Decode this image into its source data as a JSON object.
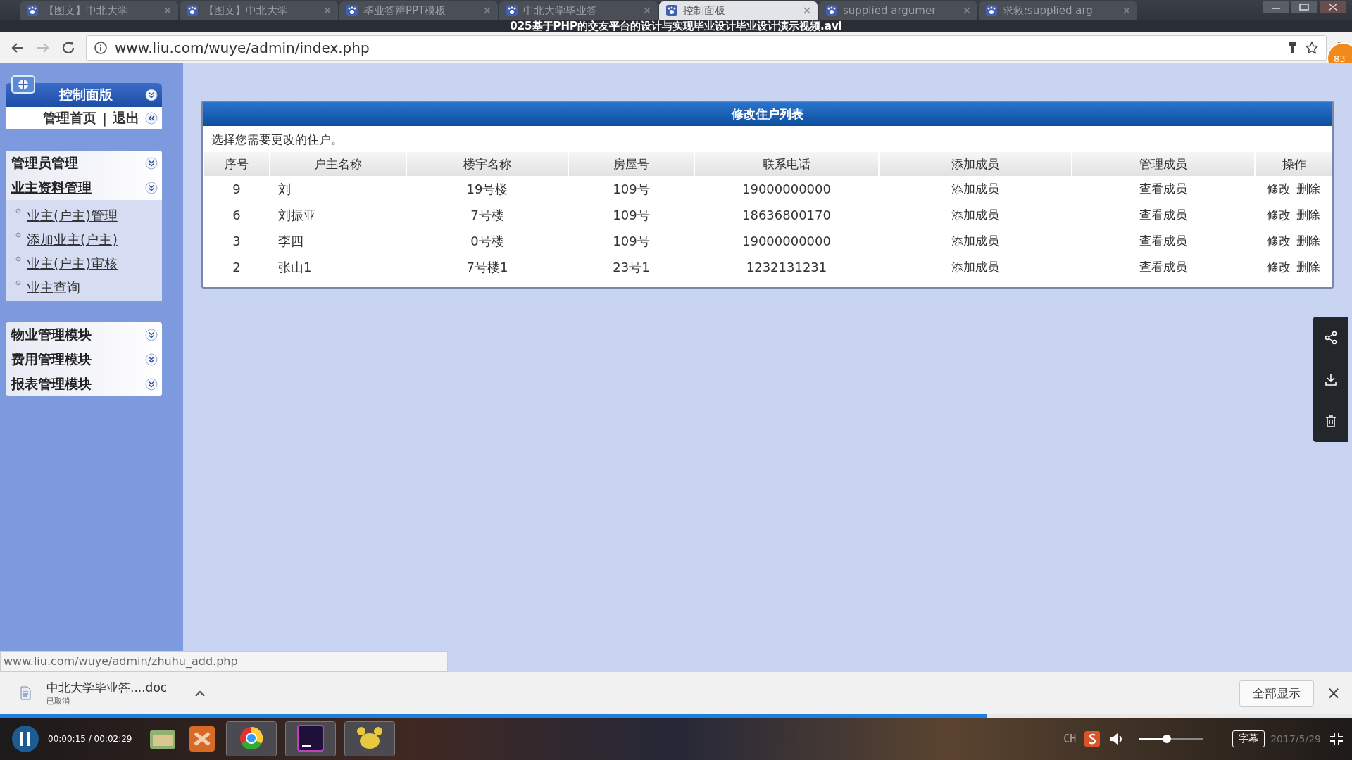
{
  "browser": {
    "tabs": [
      {
        "label": "【图文】中北大学",
        "selected": false
      },
      {
        "label": "【图文】中北大学",
        "selected": false
      },
      {
        "label": "毕业答辩PPT模板",
        "selected": false
      },
      {
        "label": "中北大学毕业答",
        "selected": false
      },
      {
        "label": "控制面板",
        "selected": true
      },
      {
        "label": "supplied argumer",
        "selected": false
      },
      {
        "label": "求救:supplied arg",
        "selected": false
      }
    ],
    "video_title": "025基于PHP的交友平台的设计与实现毕业设计毕业设计演示视频.avi",
    "address": "www.liu.com/wuye/admin/index.php",
    "profile_badge": "83"
  },
  "sidebar": {
    "panel_title": "控制面版",
    "top_links": [
      "管理首页",
      "退出"
    ],
    "separator": "|",
    "groups": [
      {
        "label": "管理员管理",
        "expanded": false
      },
      {
        "label": "业主资料管理",
        "expanded": true,
        "children": [
          "业主(户主)管理",
          "添加业主(户主)",
          "业主(户主)审核",
          "业主查询"
        ]
      },
      {
        "label": "物业管理模块",
        "expanded": false
      },
      {
        "label": "费用管理模块",
        "expanded": false
      },
      {
        "label": "报表管理模块",
        "expanded": false
      }
    ]
  },
  "content": {
    "title": "修改住户列表",
    "hint": "选择您需要更改的住户。",
    "table": {
      "columns": [
        "序号",
        "户主名称",
        "楼宇名称",
        "房屋号",
        "联系电话",
        "添加成员",
        "管理成员",
        "操作"
      ],
      "rows": [
        {
          "cells": [
            "9",
            "刘",
            "19号楼",
            "109号",
            "19000000000",
            "添加成员",
            "查看成员"
          ],
          "actions": [
            "修改",
            "删除"
          ]
        },
        {
          "cells": [
            "6",
            "刘振亚",
            "7号楼",
            "109号",
            "18636800170",
            "添加成员",
            "查看成员"
          ],
          "actions": [
            "修改",
            "删除"
          ]
        },
        {
          "cells": [
            "3",
            "李四",
            "0号楼",
            "109号",
            "19000000000",
            "添加成员",
            "查看成员"
          ],
          "actions": [
            "修改",
            "删除"
          ]
        },
        {
          "cells": [
            "2",
            "张山1",
            "7号楼1",
            "23号1",
            "1232131231",
            "添加成员",
            "查看成员"
          ],
          "actions": [
            "修改",
            "删除"
          ]
        }
      ]
    }
  },
  "status_url": "www.liu.com/wuye/admin/zhuhu_add.php",
  "download": {
    "file": "中北大学毕业答....doc",
    "state": "已取消",
    "show_all": "全部显示",
    "close": "×"
  },
  "player": {
    "progress": {
      "level": 0.73
    },
    "time": "00:00:15 / 00:02:29",
    "ime": "CH",
    "volume": {
      "level": 0.43
    },
    "subtitle": "字幕",
    "date": "2017/5/29"
  }
}
